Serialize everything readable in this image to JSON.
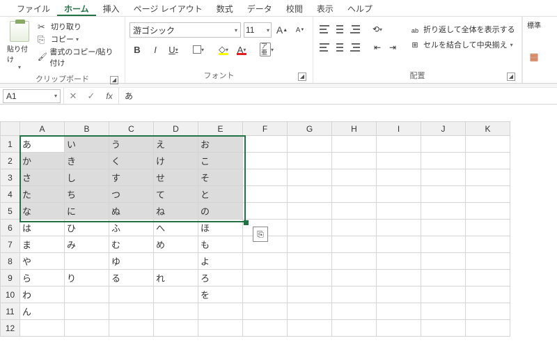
{
  "tabs": [
    "ファイル",
    "ホーム",
    "挿入",
    "ページ レイアウト",
    "数式",
    "データ",
    "校閲",
    "表示",
    "ヘルプ"
  ],
  "active_tab": 1,
  "clipboard": {
    "paste": "貼り付け",
    "cut": "切り取り",
    "copy": "コピー",
    "format_painter": "書式のコピー/貼り付け",
    "group": "クリップボード"
  },
  "font": {
    "name": "游ゴシック",
    "size": "11",
    "group": "フォント",
    "bold": "B",
    "italic": "I",
    "underline": "U",
    "ruby": "ア亜"
  },
  "align": {
    "group": "配置",
    "wrap": "折り返して全体を表示する",
    "merge": "セルを結合して中央揃え",
    "ab": "ab"
  },
  "standard": "標準",
  "namebox": "A1",
  "formula_value": "あ",
  "columns": [
    "A",
    "B",
    "C",
    "D",
    "E",
    "F",
    "G",
    "H",
    "I",
    "J",
    "K"
  ],
  "rows": [
    [
      "あ",
      "い",
      "う",
      "え",
      "お",
      "",
      "",
      "",
      "",
      "",
      ""
    ],
    [
      "か",
      "き",
      "く",
      "け",
      "こ",
      "",
      "",
      "",
      "",
      "",
      ""
    ],
    [
      "さ",
      "し",
      "す",
      "せ",
      "そ",
      "",
      "",
      "",
      "",
      "",
      ""
    ],
    [
      "た",
      "ち",
      "つ",
      "て",
      "と",
      "",
      "",
      "",
      "",
      "",
      ""
    ],
    [
      "な",
      "に",
      "ぬ",
      "ね",
      "の",
      "",
      "",
      "",
      "",
      "",
      ""
    ],
    [
      "は",
      "ひ",
      "ふ",
      "へ",
      "ほ",
      "",
      "",
      "",
      "",
      "",
      ""
    ],
    [
      "ま",
      "み",
      "む",
      "め",
      "も",
      "",
      "",
      "",
      "",
      "",
      ""
    ],
    [
      "や",
      "",
      "ゆ",
      "",
      "よ",
      "",
      "",
      "",
      "",
      "",
      ""
    ],
    [
      "ら",
      "り",
      "る",
      "れ",
      "ろ",
      "",
      "",
      "",
      "",
      "",
      ""
    ],
    [
      "わ",
      "",
      "",
      "",
      "を",
      "",
      "",
      "",
      "",
      "",
      ""
    ],
    [
      "ん",
      "",
      "",
      "",
      "",
      "",
      "",
      "",
      "",
      "",
      ""
    ],
    [
      "",
      "",
      "",
      "",
      "",
      "",
      "",
      "",
      "",
      "",
      ""
    ]
  ],
  "selection": {
    "r1": 0,
    "c1": 0,
    "r2": 4,
    "c2": 4,
    "active_r": 0,
    "active_c": 0
  }
}
